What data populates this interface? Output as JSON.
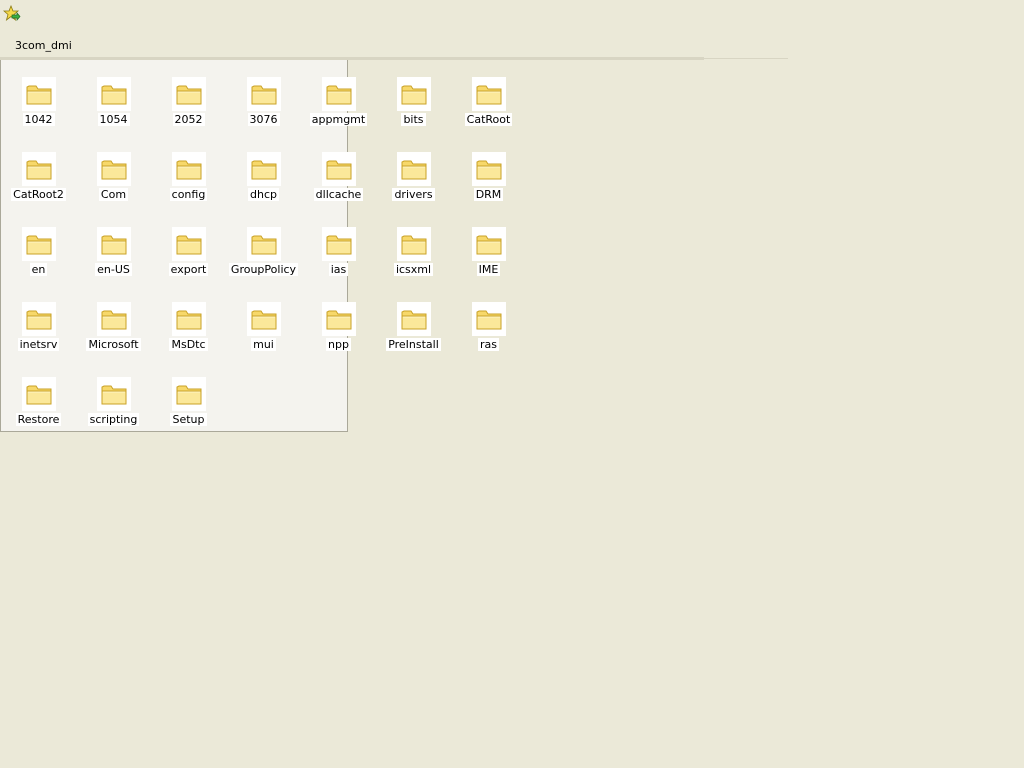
{
  "window": {
    "title": "3com_dmi",
    "top_icon": "favorites-star-arrow-icon"
  },
  "folder_icon": "folder-icon",
  "folders": [
    {
      "label": "1042"
    },
    {
      "label": "1054"
    },
    {
      "label": "2052"
    },
    {
      "label": "3076"
    },
    {
      "label": "appmgmt"
    },
    {
      "label": "bits"
    },
    {
      "label": "CatRoot"
    },
    {
      "label": "CatRoot2"
    },
    {
      "label": "Com"
    },
    {
      "label": "config"
    },
    {
      "label": "dhcp"
    },
    {
      "label": "dllcache"
    },
    {
      "label": "drivers"
    },
    {
      "label": "DRM"
    },
    {
      "label": "en"
    },
    {
      "label": "en-US"
    },
    {
      "label": "export"
    },
    {
      "label": "GroupPolicy"
    },
    {
      "label": "ias"
    },
    {
      "label": "icsxml"
    },
    {
      "label": "IME"
    },
    {
      "label": "inetsrv"
    },
    {
      "label": "Microsoft"
    },
    {
      "label": "MsDtc"
    },
    {
      "label": "mui"
    },
    {
      "label": "npp"
    },
    {
      "label": "PreInstall"
    },
    {
      "label": "ras"
    },
    {
      "label": "Restore"
    },
    {
      "label": "scripting"
    },
    {
      "label": "Setup"
    }
  ],
  "colors": {
    "background": "#ebe9d8",
    "panel": "#f4f3ee",
    "folder_fill": "#f7d86a",
    "folder_stroke": "#c9a227"
  }
}
